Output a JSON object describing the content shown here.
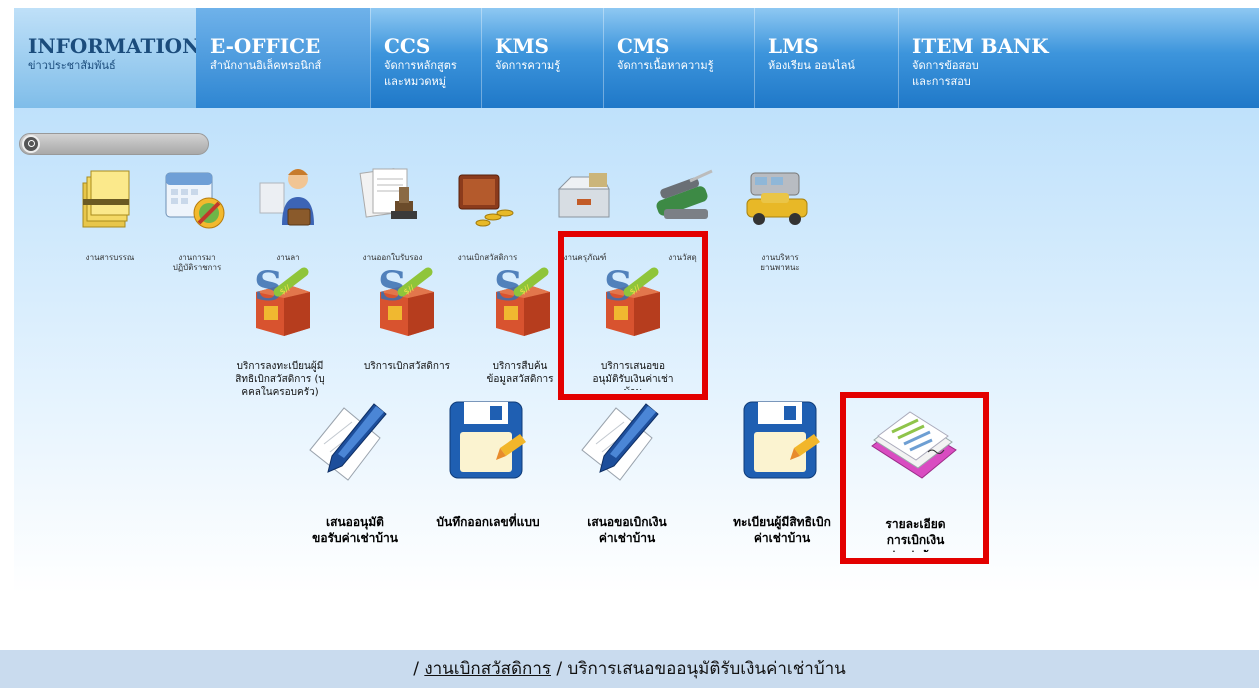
{
  "nav": [
    {
      "title": "INFORMATION",
      "sub": "ข่าวประชาสัมพันธ์"
    },
    {
      "title": "E-OFFICE",
      "sub": "สำนักงานอิเล็คทรอนิกส์"
    },
    {
      "title": "CCS",
      "sub": "จัดการหลักสูตร\nและหมวดหมู่"
    },
    {
      "title": "KMS",
      "sub": "จัดการความรู้"
    },
    {
      "title": "CMS",
      "sub": "จัดการเนื้อหาความรู้"
    },
    {
      "title": "LMS",
      "sub": "ห้องเรียน ออนไลน์"
    },
    {
      "title": "ITEM BANK",
      "sub": "จัดการข้อสอบ\nและการสอบ"
    }
  ],
  "row1": [
    {
      "label": "งานสารบรรณ"
    },
    {
      "label": "งานการมา\nปฏิบัติราชการ"
    },
    {
      "label": "งานลา"
    },
    {
      "label": "งานออกใบรับรอง"
    },
    {
      "label": "งานเบิกสวัสดิการ"
    },
    {
      "label": "งานครุภัณฑ์"
    },
    {
      "label": "งานวัสดุ"
    },
    {
      "label": "งานบริหาร\nยานพาหนะ"
    }
  ],
  "row2": [
    {
      "label": "บริการลงทะเบียนผู้มี\nสิทธิเบิกสวัสดิการ (บุ\nคคลในครอบครัว)"
    },
    {
      "label": "บริการเบิกสวัสดิการ"
    },
    {
      "label": "บริการสืบค้น\nข้อมูลสวัสดิการ"
    },
    {
      "label": "บริการเสนอขอ\nอนุมัติรับเงินค่าเช่า\nบ้าน"
    }
  ],
  "row3": [
    {
      "label": "เสนออนุมัติ\nขอรับค่าเช่าบ้าน"
    },
    {
      "label": "บันทึกออกเลขที่แบบ"
    },
    {
      "label": "เสนอขอเบิกเงิน\nค่าเช่าบ้าน"
    },
    {
      "label": "ทะเบียนผู้มีสิทธิเบิก\nค่าเช่าบ้าน"
    },
    {
      "label": "รายละเอียด\nการเบิกเงิน\nค่าเช่าบ้าน"
    }
  ],
  "breadcrumb": {
    "sep1": "/",
    "link": "งานเบิกสวัสดิการ",
    "sep2": "/",
    "current": "บริการเสนอขออนุมัติรับเงินค่าเช่าบ้าน"
  },
  "colors": {
    "nav": "#2b86d2",
    "highlight": "#e30000",
    "footer": "#c9dbee"
  }
}
